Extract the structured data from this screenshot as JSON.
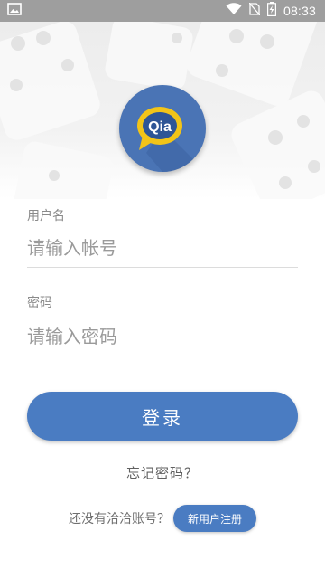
{
  "status_bar": {
    "time": "08:33",
    "icons": [
      "image-icon",
      "wifi-icon",
      "no-sim-icon",
      "battery-charging-icon"
    ]
  },
  "logo": {
    "text": "Qia",
    "icon": "chat-bubble-logo-icon",
    "colors": {
      "circle": "#4a74b5",
      "bubble": "#f2c418",
      "bubble_inner": "#2e5596"
    }
  },
  "form": {
    "username": {
      "label": "用户名",
      "placeholder": "请输入帐号",
      "value": ""
    },
    "password": {
      "label": "密码",
      "placeholder": "请输入密码",
      "value": ""
    },
    "login_label": "登录"
  },
  "forgot_password": "忘记密码？",
  "register": {
    "prompt": "还没有洽洽账号？",
    "button_label": "新用户注册"
  },
  "colors": {
    "accent": "#4a7cc2",
    "status_bar": "#9e9e9e"
  }
}
